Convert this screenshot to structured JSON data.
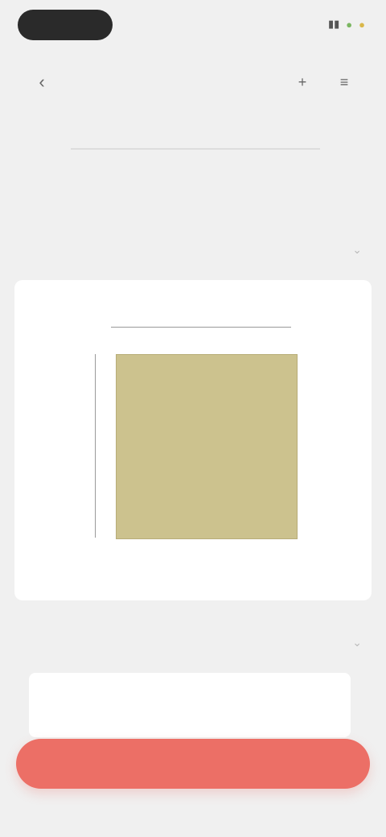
{
  "status_bar": {
    "time": "",
    "signal_icon": "signal-icon",
    "wifi_icon": "wifi-icon",
    "battery_icon": "battery-icon"
  },
  "nav": {
    "title": "",
    "back_icon": "chevron-left-icon",
    "action_1_icon": "plus-icon",
    "action_2_icon": "menu-icon"
  },
  "progress": {
    "left_label": "",
    "right_label": "",
    "fill_fraction": 0.0
  },
  "section_1": {
    "title": "",
    "subtitle": ""
  },
  "diagram": {
    "top_dimension": "",
    "left_dimension": "",
    "board_top_label": "",
    "board_side_label": "",
    "board_color": "#ccc28e"
  },
  "notes": {
    "title": "",
    "text": ""
  },
  "primary_button": {
    "label": "",
    "color": "#ec6f66"
  }
}
